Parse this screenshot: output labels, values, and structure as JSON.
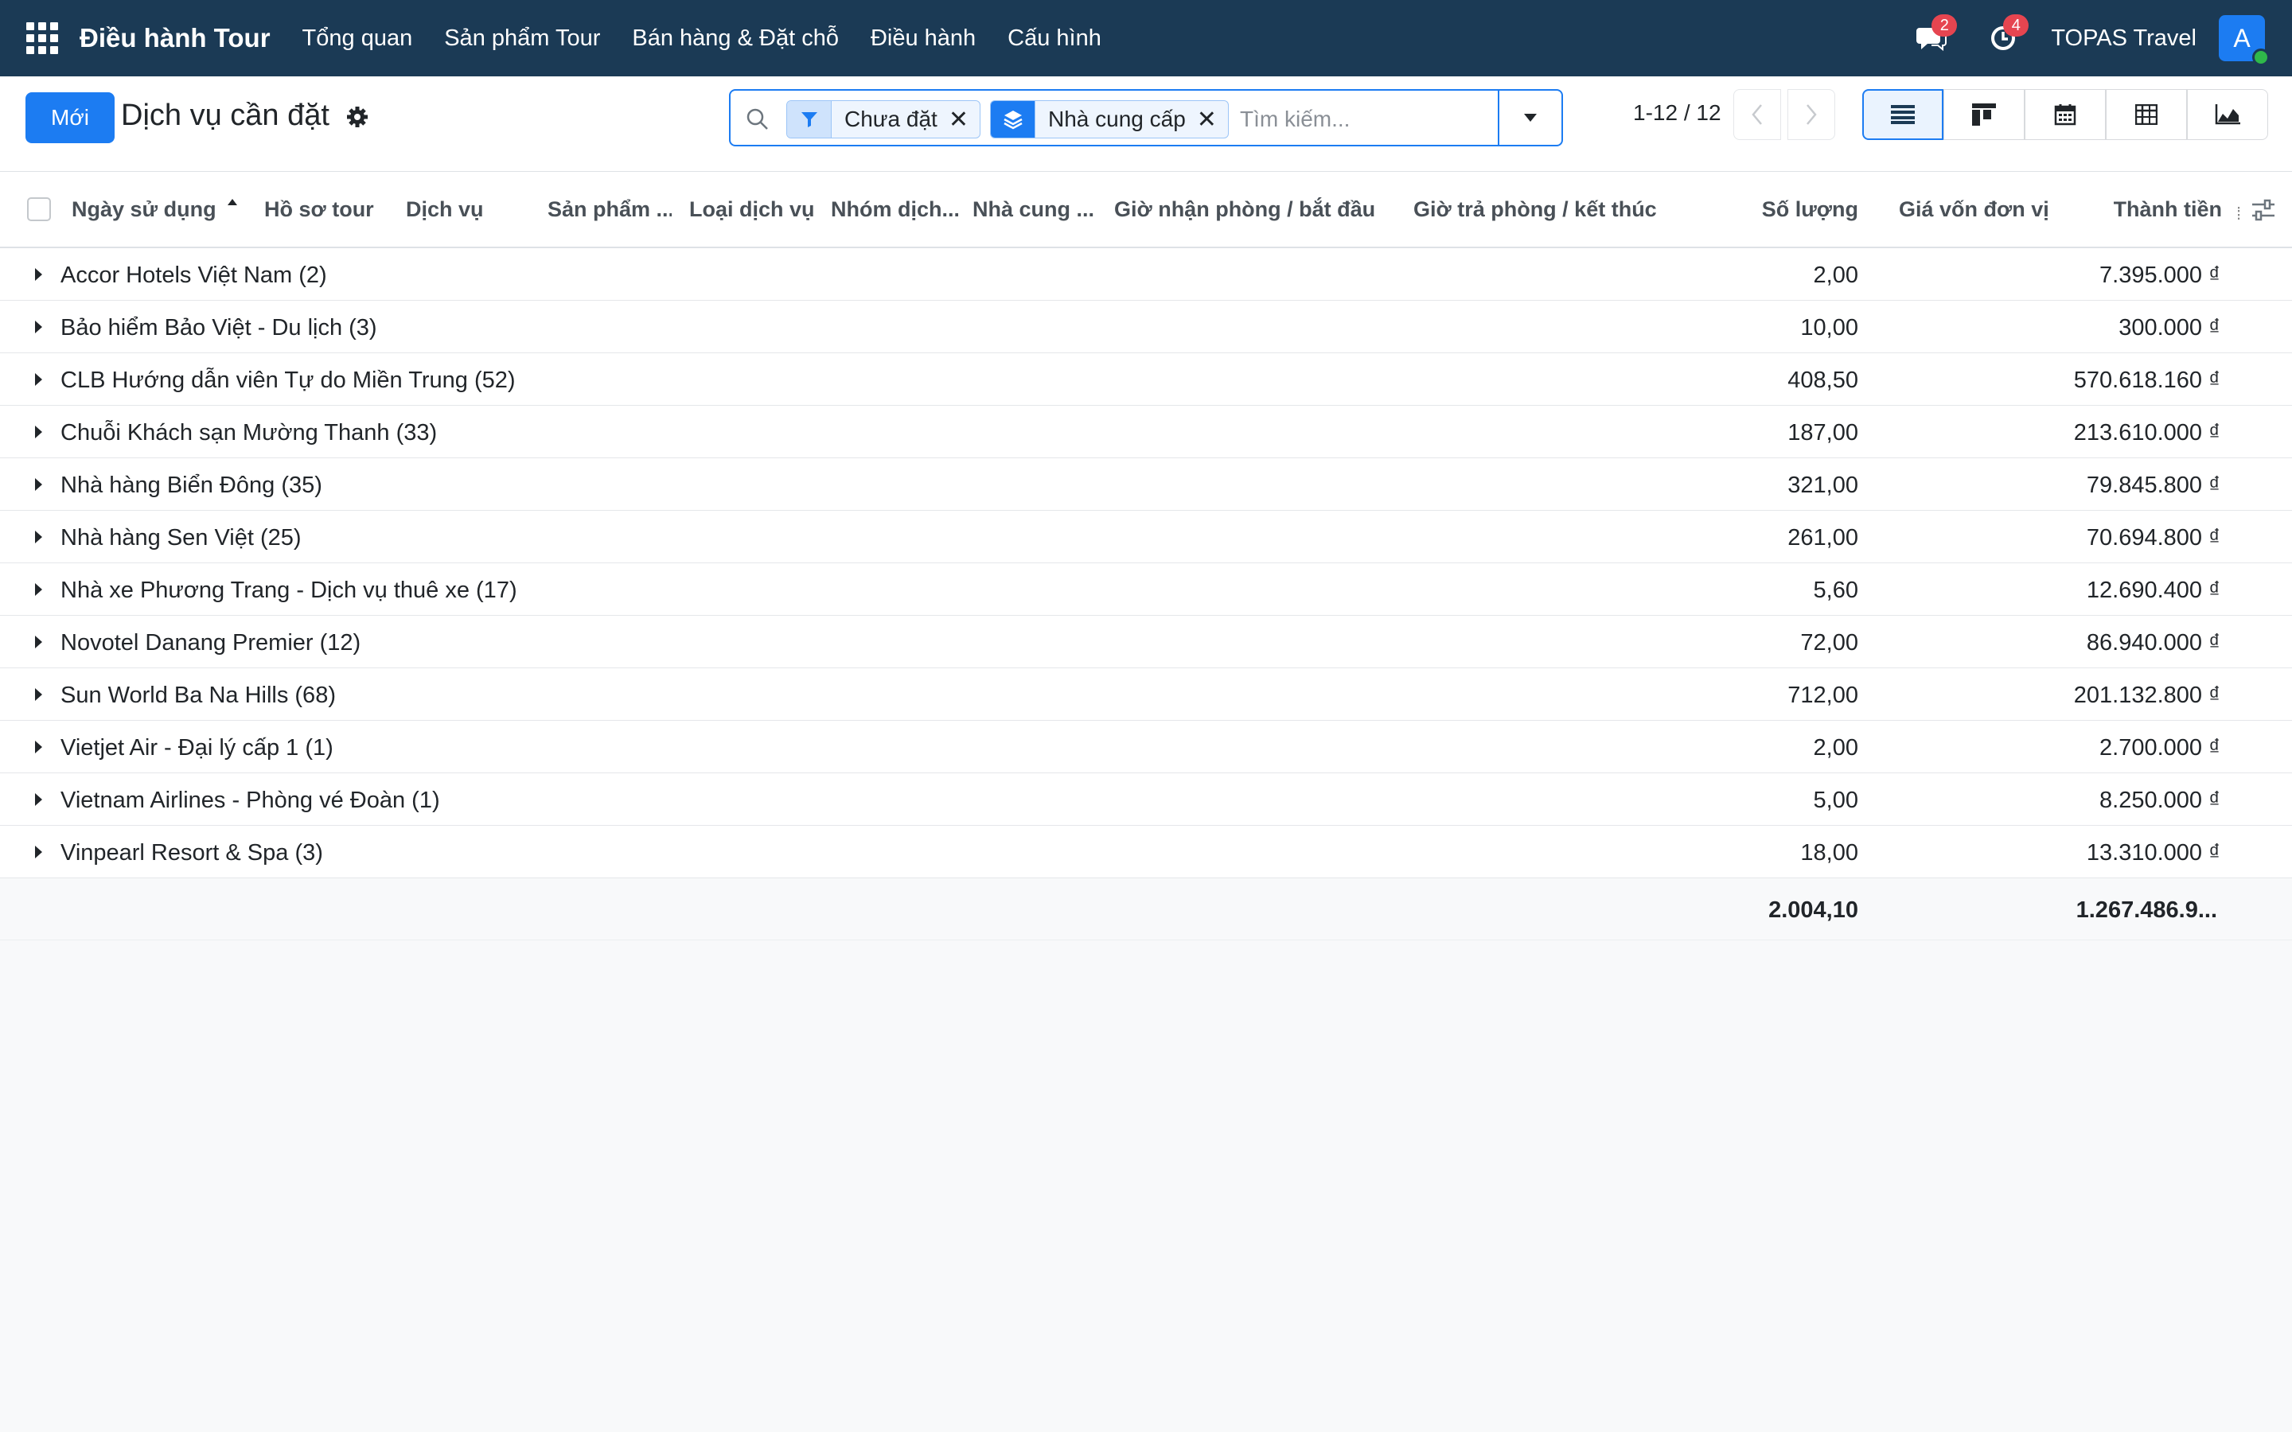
{
  "navbar": {
    "brand": "Điều hành Tour",
    "menu": [
      "Tổng quan",
      "Sản phẩm Tour",
      "Bán hàng & Đặt chỗ",
      "Điều hành",
      "Cấu hình"
    ],
    "messages_badge": "2",
    "activities_badge": "4",
    "company": "TOPAS Travel",
    "avatar_letter": "A"
  },
  "control": {
    "new_button": "Mới",
    "title": "Dịch vụ cần đặt",
    "search": {
      "facets": [
        {
          "icon": "filter-icon",
          "label": "Chưa đặt"
        },
        {
          "icon": "group-by-layers-icon",
          "label": "Nhà cung cấp"
        }
      ],
      "placeholder": "Tìm kiếm..."
    },
    "pager": "1-12 / 12",
    "views": [
      "list-view-icon",
      "kanban-view-icon",
      "calendar-view-icon",
      "pivot-view-icon",
      "graph-view-icon"
    ]
  },
  "list": {
    "columns": [
      "Ngày sử dụng",
      "Hồ sơ tour",
      "Dịch vụ",
      "Sản phẩm ...",
      "Loại dịch vụ",
      "Nhóm dịch...",
      "Nhà cung ...",
      "Giờ nhận phòng / bắt đầu",
      "Giờ trả phòng / kết thúc",
      "Số lượng",
      "Giá vốn đơn vị",
      "Thành tiền"
    ],
    "groups": [
      {
        "name": "Accor Hotels Việt Nam (2)",
        "qty": "2,00",
        "total": "7.395.000 ₫"
      },
      {
        "name": "Bảo hiểm Bảo Việt - Du lịch (3)",
        "qty": "10,00",
        "total": "300.000 ₫"
      },
      {
        "name": "CLB Hướng dẫn viên Tự do Miền Trung (52)",
        "qty": "408,50",
        "total": "570.618.160 ₫"
      },
      {
        "name": "Chuỗi Khách sạn Mường Thanh (33)",
        "qty": "187,00",
        "total": "213.610.000 ₫"
      },
      {
        "name": "Nhà hàng Biển Đông (35)",
        "qty": "321,00",
        "total": "79.845.800 ₫"
      },
      {
        "name": "Nhà hàng Sen Việt (25)",
        "qty": "261,00",
        "total": "70.694.800 ₫"
      },
      {
        "name": "Nhà xe Phương Trang - Dịch vụ thuê xe (17)",
        "qty": "5,60",
        "total": "12.690.400 ₫"
      },
      {
        "name": "Novotel Danang Premier (12)",
        "qty": "72,00",
        "total": "86.940.000 ₫"
      },
      {
        "name": "Sun World Ba Na Hills (68)",
        "qty": "712,00",
        "total": "201.132.800 ₫"
      },
      {
        "name": "Vietjet Air - Đại lý cấp 1 (1)",
        "qty": "2,00",
        "total": "2.700.000 ₫"
      },
      {
        "name": "Vietnam Airlines - Phòng vé Đoàn (1)",
        "qty": "5,00",
        "total": "8.250.000 ₫"
      },
      {
        "name": "Vinpearl Resort & Spa (3)",
        "qty": "18,00",
        "total": "13.310.000 ₫"
      }
    ],
    "footer": {
      "qty": "2.004,10",
      "total": "1.267.486.9..."
    }
  },
  "colors": {
    "navbar": "#1b3a55",
    "primary": "#1c7cf2",
    "badge": "#e64550",
    "online": "#2fb84a"
  }
}
